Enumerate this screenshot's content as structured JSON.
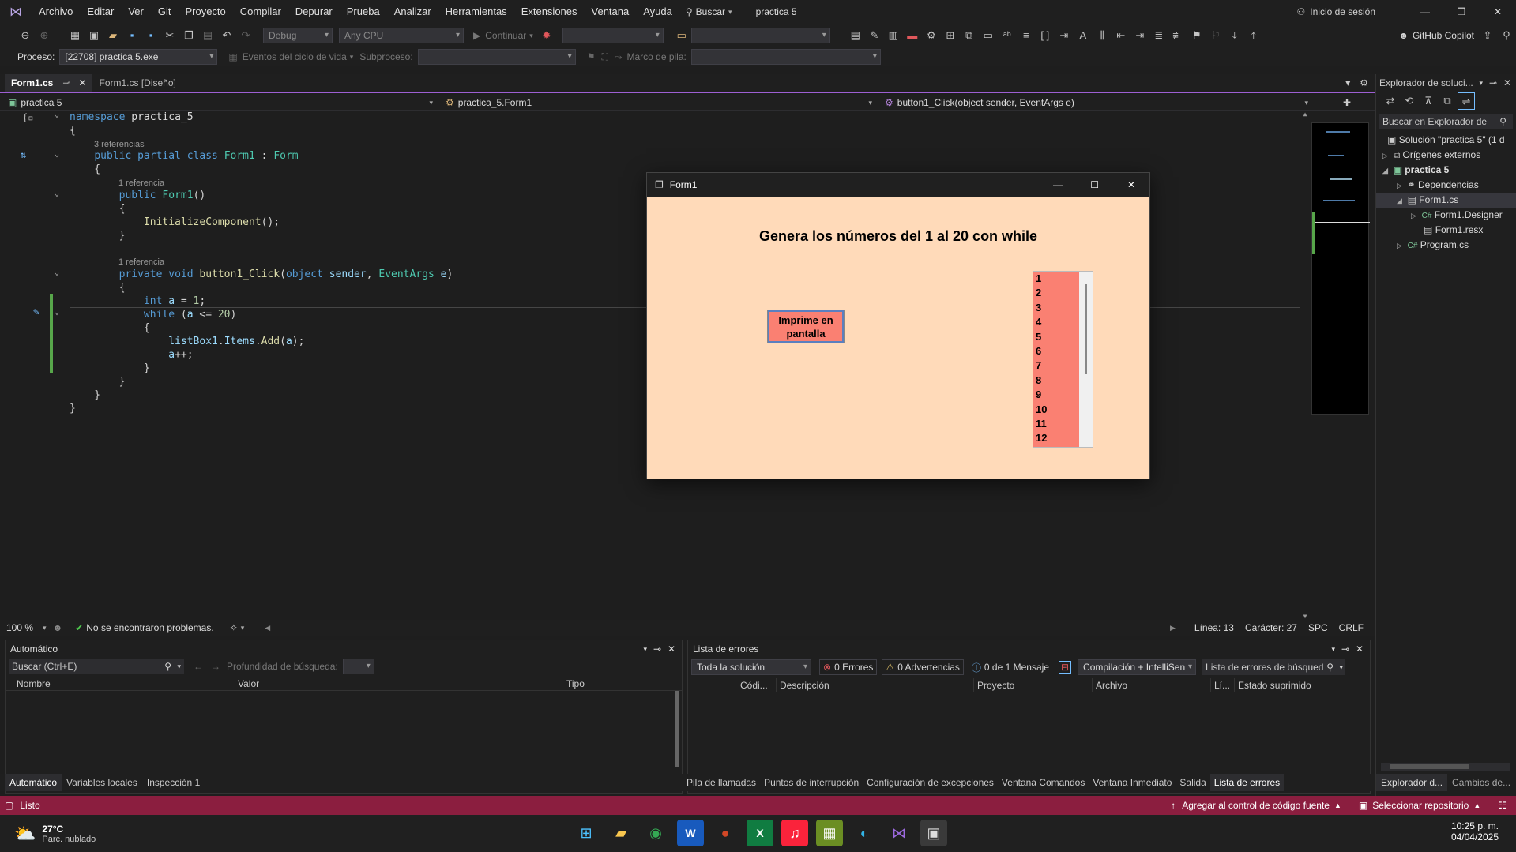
{
  "menubar": {
    "items": [
      "Archivo",
      "Editar",
      "Ver",
      "Git",
      "Proyecto",
      "Compilar",
      "Depurar",
      "Prueba",
      "Analizar",
      "Herramientas",
      "Extensiones",
      "Ventana",
      "Ayuda"
    ],
    "search": "Buscar",
    "project_title": "practica 5",
    "login": "Inicio de sesión"
  },
  "toolbar": {
    "config": "Debug",
    "platform": "Any CPU",
    "continue": "Continuar",
    "copilot": "GitHub Copilot",
    "process_label": "Proceso:",
    "process_value": "[22708] practica 5.exe",
    "lifecycle": "Eventos del ciclo de vida",
    "thread_label": "Subproceso:",
    "stack_label": "Marco de pila:"
  },
  "tabs": [
    "Form1.cs",
    "Form1.cs [Diseño]"
  ],
  "navbar": {
    "project": "practica 5",
    "class": "practica_5.Form1",
    "member": "button1_Click(object sender, EventArgs e)"
  },
  "code": {
    "refs3": "3 referencias",
    "refs1a": "1 referencia",
    "refs1b": "1 referencia"
  },
  "status_line": {
    "zoom": "100 %",
    "problems": "No se encontraron problemas.",
    "line": "Línea: 13",
    "char": "Carácter: 27",
    "spc": "SPC",
    "crlf": "CRLF"
  },
  "solution_explorer": {
    "title": "Explorador de soluci...",
    "search": "Buscar en Explorador de",
    "items": [
      "Solución \"practica 5\" (1 d",
      "Orígenes externos",
      "practica 5",
      "Dependencias",
      "Form1.cs",
      "Form1.Designer",
      "Form1.resx",
      "Program.cs"
    ],
    "tab1": "Explorador d...",
    "tab2": "Cambios de..."
  },
  "autos": {
    "title": "Automático",
    "search": "Buscar (Ctrl+E)",
    "depth": "Profundidad de búsqueda:",
    "columns": [
      "Nombre",
      "Valor",
      "Tipo"
    ]
  },
  "errors": {
    "title": "Lista de errores",
    "scope": "Toda la solución",
    "errors": "0 Errores",
    "warnings": "0 Advertencias",
    "messages": "0 de 1 Mensaje",
    "build": "Compilación + IntelliSen",
    "search": "Lista de errores de búsqued",
    "columns": [
      "Códi...",
      "Descripción",
      "Proyecto",
      "Archivo",
      "Lí...",
      "Estado suprimido"
    ]
  },
  "bottom_tabs_left": [
    "Automático",
    "Variables locales",
    "Inspección 1"
  ],
  "bottom_tabs_right": [
    "Pila de llamadas",
    "Puntos de interrupción",
    "Configuración de excepciones",
    "Ventana Comandos",
    "Ventana Inmediato",
    "Salida",
    "Lista de errores"
  ],
  "statusbar": {
    "ready": "Listo",
    "source_control": "Agregar al control de código fuente",
    "repo": "Seleccionar repositorio"
  },
  "taskbar": {
    "temp": "27°C",
    "weather": "Parc. nublado",
    "time": "10:25 p. m.",
    "date": "04/04/2025"
  },
  "form": {
    "title": "Form1",
    "heading": "Genera los números del 1 al 20 con while",
    "button": "Imprime en pantalla",
    "list_items": [
      "1",
      "2",
      "3",
      "4",
      "5",
      "6",
      "7",
      "8",
      "9",
      "10",
      "11",
      "12"
    ],
    "bg_color": "#ffdab9",
    "accent_color": "#fa8072"
  }
}
